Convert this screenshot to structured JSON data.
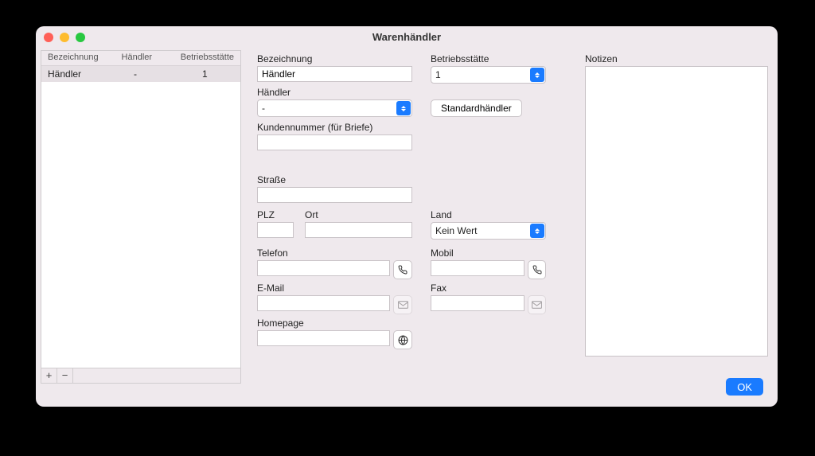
{
  "window": {
    "title": "Warenhändler"
  },
  "table": {
    "headers": {
      "col1": "Bezeichnung",
      "col2": "Händler",
      "col3": "Betriebsstätte"
    },
    "rows": [
      {
        "col1": "Händler",
        "col2": "-",
        "col3": "1"
      }
    ],
    "add": "+",
    "remove": "−"
  },
  "form": {
    "bezeichnung": {
      "label": "Bezeichnung",
      "value": "Händler"
    },
    "haendler": {
      "label": "Händler",
      "value": "-"
    },
    "kundennr": {
      "label": "Kundennummer (für Briefe)",
      "value": ""
    },
    "betriebsstaette": {
      "label": "Betriebsstätte",
      "value": "1"
    },
    "standard_btn": "Standardhändler",
    "strasse": {
      "label": "Straße",
      "value": ""
    },
    "plz": {
      "label": "PLZ",
      "value": ""
    },
    "ort": {
      "label": "Ort",
      "value": ""
    },
    "land": {
      "label": "Land",
      "value": "Kein Wert"
    },
    "telefon": {
      "label": "Telefon",
      "value": ""
    },
    "mobil": {
      "label": "Mobil",
      "value": ""
    },
    "email": {
      "label": "E-Mail",
      "value": ""
    },
    "fax": {
      "label": "Fax",
      "value": ""
    },
    "homepage": {
      "label": "Homepage",
      "value": ""
    },
    "notizen": {
      "label": "Notizen",
      "value": ""
    }
  },
  "buttons": {
    "ok": "OK"
  }
}
